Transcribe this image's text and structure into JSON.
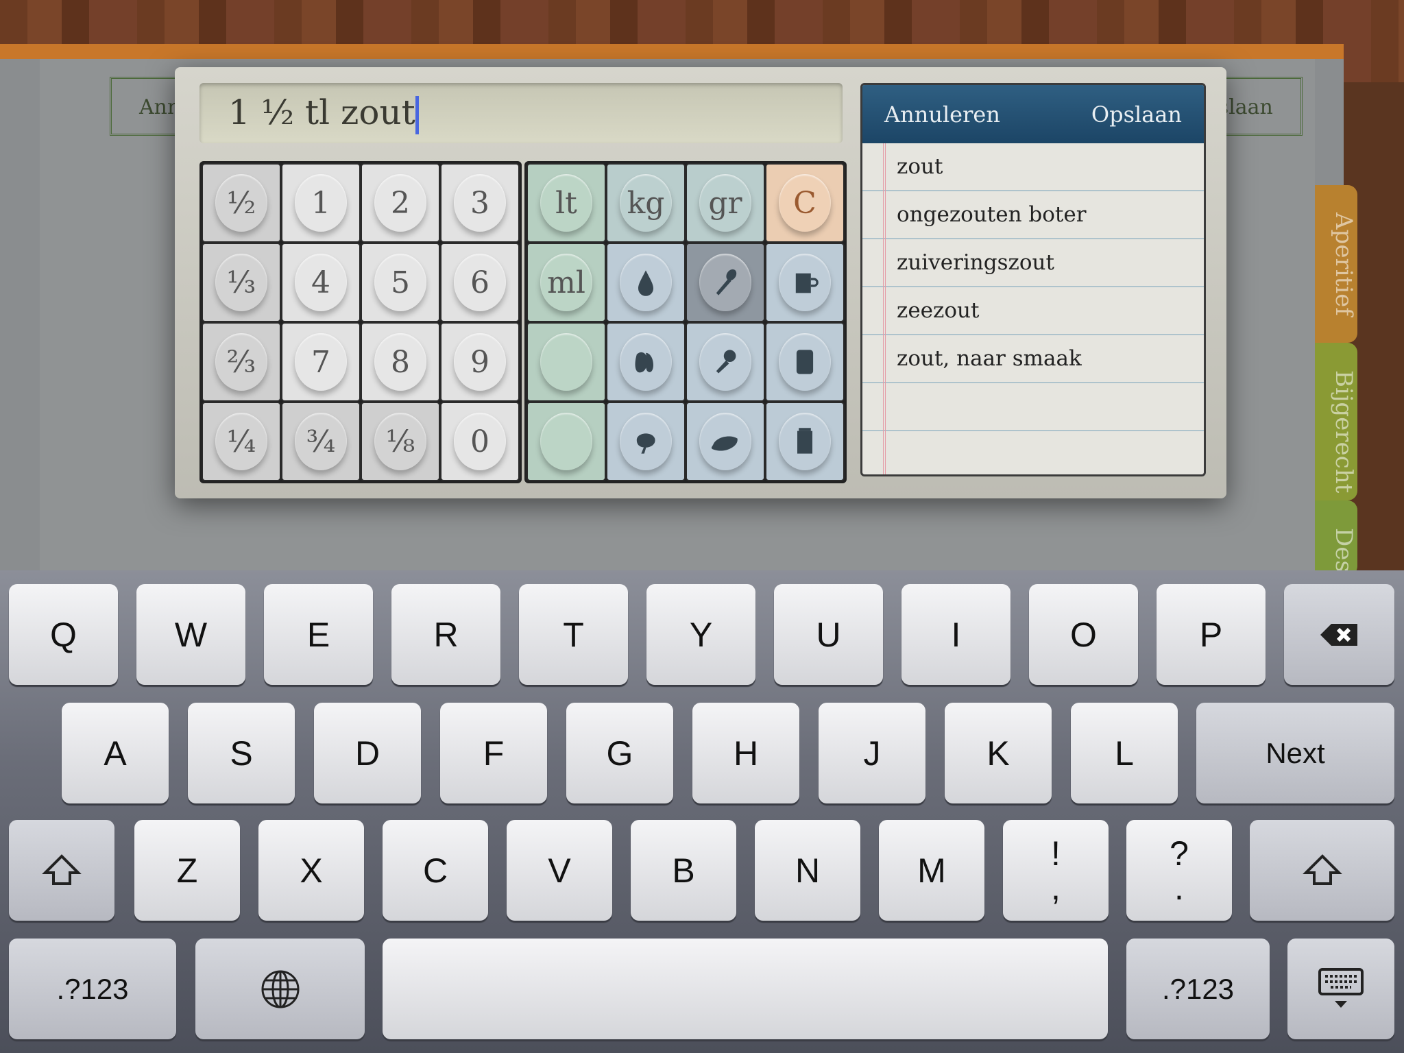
{
  "background": {
    "left_button": "Annuleren",
    "right_button": "Opslaan",
    "tabs": [
      "Aperitief",
      "Bijgerecht",
      "Dessert"
    ]
  },
  "input": {
    "value": "1 ½ tl zout"
  },
  "keypad": {
    "numbers": [
      [
        "½",
        "1",
        "2",
        "3"
      ],
      [
        "⅓",
        "4",
        "5",
        "6"
      ],
      [
        "⅔",
        "7",
        "8",
        "9"
      ],
      [
        "¼",
        "¾",
        "⅛",
        "0"
      ]
    ],
    "units": [
      [
        "lt",
        "kg",
        "gr",
        "C"
      ],
      [
        "ml",
        "drop-icon",
        "teaspoon-icon",
        "cup-icon"
      ],
      [
        "",
        "clove-icon",
        "measuring-spoon-icon",
        "can-icon"
      ],
      [
        "",
        "herb-bunch-icon",
        "handful-icon",
        "package-icon"
      ]
    ],
    "selected": "teaspoon-icon",
    "colors": {
      "accent_clear": "#ebcdb2",
      "header": "#1c4566",
      "caret": "#4866e0"
    }
  },
  "suggestions": {
    "cancel": "Annuleren",
    "save": "Opslaan",
    "items": [
      "zout",
      "ongezouten boter",
      "zuiveringszout",
      "zeezout",
      "zout, naar smaak"
    ]
  },
  "keyboard": {
    "row1": [
      "Q",
      "W",
      "E",
      "R",
      "T",
      "Y",
      "U",
      "I",
      "O",
      "P"
    ],
    "row2": [
      "A",
      "S",
      "D",
      "F",
      "G",
      "H",
      "J",
      "K",
      "L"
    ],
    "next": "Next",
    "row3": [
      "Z",
      "X",
      "C",
      "V",
      "B",
      "N",
      "M"
    ],
    "punct1": [
      "!",
      ","
    ],
    "punct2": [
      "?",
      "."
    ],
    "numbers_key": ".?123"
  }
}
